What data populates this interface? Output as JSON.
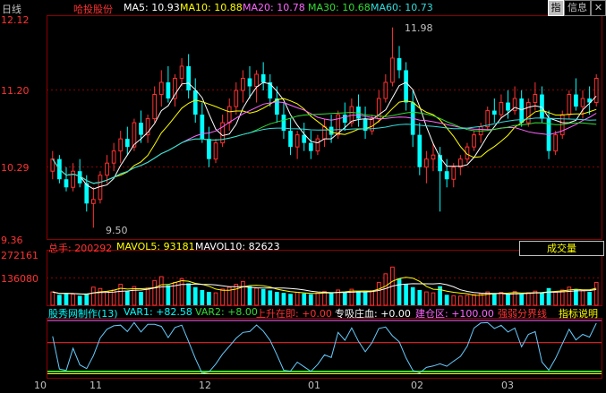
{
  "header": {
    "period": "日线",
    "stock_name": "哈投股份",
    "ma": [
      {
        "label": "MA5: 10.93",
        "color": "#ffffff"
      },
      {
        "label": "MA10: 10.88",
        "color": "#ffff00"
      },
      {
        "label": "MA20: 10.78",
        "color": "#ff66ff"
      },
      {
        "label": "MA30: 10.68",
        "color": "#33dd33"
      },
      {
        "label": "MA60: 10.73",
        "color": "#33dddd"
      }
    ],
    "buttons": {
      "zhi": "指",
      "xinxi": "信息",
      "close": "✕"
    }
  },
  "price_panel": {
    "y_ticks": [
      "12.12",
      "11.20",
      "10.29",
      "9.36"
    ],
    "ymin": 9.36,
    "ymax": 12.12,
    "high_label": "11.98",
    "low_label": "9.50"
  },
  "volume_panel": {
    "header": "总手: 200292",
    "mavol5": "MAVOL5: 93181",
    "mavol10": "MAVOL10: 82623",
    "y_ticks": [
      "272161",
      "136080"
    ],
    "vmax": 272161,
    "select_label": "成交量"
  },
  "indicator_panel": {
    "name": "股秀网制作(13)",
    "var1": "VAR1: +82.58",
    "var2": "VAR2: +8.00",
    "item1": "上升在即: +0.00",
    "item2": "专吸庄血: +0.00",
    "item3": "建仓区: +100.00",
    "item4": "强弱分界线",
    "help_button": "指标说明"
  },
  "x_axis": [
    "10",
    "11",
    "12",
    "01",
    "02",
    "03"
  ],
  "colors": {
    "up": "#ff3232",
    "down": "#00ffff",
    "grid": "#8b0000",
    "axis_text": "#c0c0c0"
  },
  "chart_data": {
    "type": "candlestick",
    "title": "哈投股份 日线",
    "ohlc": [
      [
        10.2,
        10.45,
        10.1,
        10.35
      ],
      [
        10.35,
        10.4,
        10.05,
        10.1
      ],
      [
        10.1,
        10.25,
        9.95,
        10.0
      ],
      [
        10.0,
        10.3,
        9.95,
        10.2
      ],
      [
        10.2,
        10.35,
        10.0,
        10.05
      ],
      [
        10.05,
        10.15,
        9.7,
        9.8
      ],
      [
        9.8,
        10.0,
        9.5,
        9.85
      ],
      [
        9.85,
        10.2,
        9.8,
        10.15
      ],
      [
        10.15,
        10.4,
        10.05,
        10.3
      ],
      [
        10.3,
        10.55,
        10.2,
        10.45
      ],
      [
        10.45,
        10.7,
        10.3,
        10.6
      ],
      [
        10.6,
        10.75,
        10.4,
        10.5
      ],
      [
        10.5,
        10.85,
        10.45,
        10.8
      ],
      [
        10.8,
        10.95,
        10.55,
        10.65
      ],
      [
        10.65,
        10.9,
        10.55,
        10.85
      ],
      [
        10.85,
        11.25,
        10.8,
        11.15
      ],
      [
        11.15,
        11.45,
        11.0,
        11.3
      ],
      [
        11.3,
        11.5,
        11.05,
        11.1
      ],
      [
        11.1,
        11.4,
        11.0,
        11.35
      ],
      [
        11.35,
        11.6,
        11.25,
        11.5
      ],
      [
        11.5,
        11.65,
        11.1,
        11.2
      ],
      [
        11.2,
        11.35,
        10.8,
        10.9
      ],
      [
        10.9,
        11.05,
        10.55,
        10.6
      ],
      [
        10.6,
        10.75,
        10.25,
        10.35
      ],
      [
        10.35,
        10.6,
        10.3,
        10.55
      ],
      [
        10.55,
        10.9,
        10.5,
        10.8
      ],
      [
        10.8,
        11.1,
        10.7,
        11.0
      ],
      [
        11.0,
        11.3,
        10.9,
        11.2
      ],
      [
        11.2,
        11.45,
        11.05,
        11.35
      ],
      [
        11.35,
        11.5,
        11.1,
        11.25
      ],
      [
        11.25,
        11.45,
        11.05,
        11.4
      ],
      [
        11.4,
        11.55,
        11.2,
        11.3
      ],
      [
        11.3,
        11.4,
        11.0,
        11.1
      ],
      [
        11.1,
        11.25,
        10.8,
        10.9
      ],
      [
        10.9,
        11.05,
        10.6,
        10.7
      ],
      [
        10.7,
        10.85,
        10.4,
        10.5
      ],
      [
        10.5,
        10.7,
        10.35,
        10.65
      ],
      [
        10.65,
        10.8,
        10.45,
        10.55
      ],
      [
        10.55,
        10.7,
        10.35,
        10.45
      ],
      [
        10.45,
        10.65,
        10.4,
        10.6
      ],
      [
        10.6,
        10.85,
        10.5,
        10.75
      ],
      [
        10.75,
        10.9,
        10.55,
        10.65
      ],
      [
        10.65,
        10.95,
        10.6,
        10.9
      ],
      [
        10.9,
        11.05,
        10.7,
        10.8
      ],
      [
        10.8,
        11.1,
        10.75,
        11.0
      ],
      [
        11.0,
        11.15,
        10.75,
        10.85
      ],
      [
        10.85,
        11.0,
        10.6,
        10.7
      ],
      [
        10.7,
        10.9,
        10.65,
        10.85
      ],
      [
        10.85,
        11.2,
        10.8,
        11.1
      ],
      [
        11.1,
        11.4,
        11.05,
        11.3
      ],
      [
        11.3,
        11.98,
        11.25,
        11.6
      ],
      [
        11.6,
        11.75,
        11.35,
        11.45
      ],
      [
        11.45,
        11.55,
        10.95,
        11.05
      ],
      [
        11.05,
        11.2,
        10.5,
        10.65
      ],
      [
        10.65,
        10.8,
        10.15,
        10.25
      ],
      [
        10.25,
        10.45,
        10.05,
        10.35
      ],
      [
        10.35,
        10.55,
        10.2,
        10.4
      ],
      [
        10.4,
        10.5,
        9.7,
        10.2
      ],
      [
        10.2,
        10.35,
        10.0,
        10.1
      ],
      [
        10.1,
        10.3,
        10.0,
        10.25
      ],
      [
        10.25,
        10.4,
        10.15,
        10.35
      ],
      [
        10.35,
        10.55,
        10.3,
        10.5
      ],
      [
        10.5,
        10.7,
        10.45,
        10.65
      ],
      [
        10.65,
        10.8,
        10.55,
        10.75
      ],
      [
        10.75,
        11.0,
        10.7,
        10.95
      ],
      [
        10.95,
        11.1,
        10.8,
        10.9
      ],
      [
        10.9,
        11.15,
        10.85,
        11.05
      ],
      [
        11.05,
        11.2,
        10.85,
        10.95
      ],
      [
        10.95,
        11.25,
        10.9,
        11.1
      ],
      [
        11.1,
        11.2,
        10.75,
        10.8
      ],
      [
        10.8,
        11.1,
        10.75,
        11.05
      ],
      [
        11.05,
        11.3,
        10.95,
        11.15
      ],
      [
        11.15,
        11.25,
        10.8,
        10.85
      ],
      [
        10.85,
        10.95,
        10.35,
        10.45
      ],
      [
        10.45,
        10.7,
        10.4,
        10.65
      ],
      [
        10.65,
        10.95,
        10.6,
        10.9
      ],
      [
        10.9,
        11.2,
        10.85,
        11.15
      ],
      [
        11.15,
        11.35,
        10.95,
        11.0
      ],
      [
        11.0,
        11.2,
        10.85,
        11.1
      ],
      [
        11.1,
        11.25,
        10.9,
        11.05
      ],
      [
        11.05,
        11.4,
        11.0,
        11.35
      ]
    ],
    "volume": [
      70000,
      55000,
      62000,
      58000,
      50000,
      60000,
      95000,
      88000,
      72000,
      80000,
      110000,
      75000,
      98000,
      70000,
      90000,
      130000,
      150000,
      105000,
      120000,
      140000,
      115000,
      95000,
      80000,
      70000,
      65000,
      85000,
      95000,
      110000,
      125000,
      100000,
      90000,
      85000,
      78000,
      70000,
      65000,
      60000,
      68000,
      62000,
      58000,
      64000,
      72000,
      66000,
      80000,
      70000,
      84000,
      74000,
      68000,
      76000,
      120000,
      165000,
      200292,
      140000,
      110000,
      95000,
      80000,
      70000,
      65000,
      100000,
      55000,
      50000,
      48000,
      52000,
      56000,
      60000,
      70000,
      62000,
      68000,
      60000,
      72000,
      58000,
      66000,
      74000,
      64000,
      90000,
      70000,
      80000,
      95000,
      85000,
      76000,
      70000,
      120000
    ]
  }
}
